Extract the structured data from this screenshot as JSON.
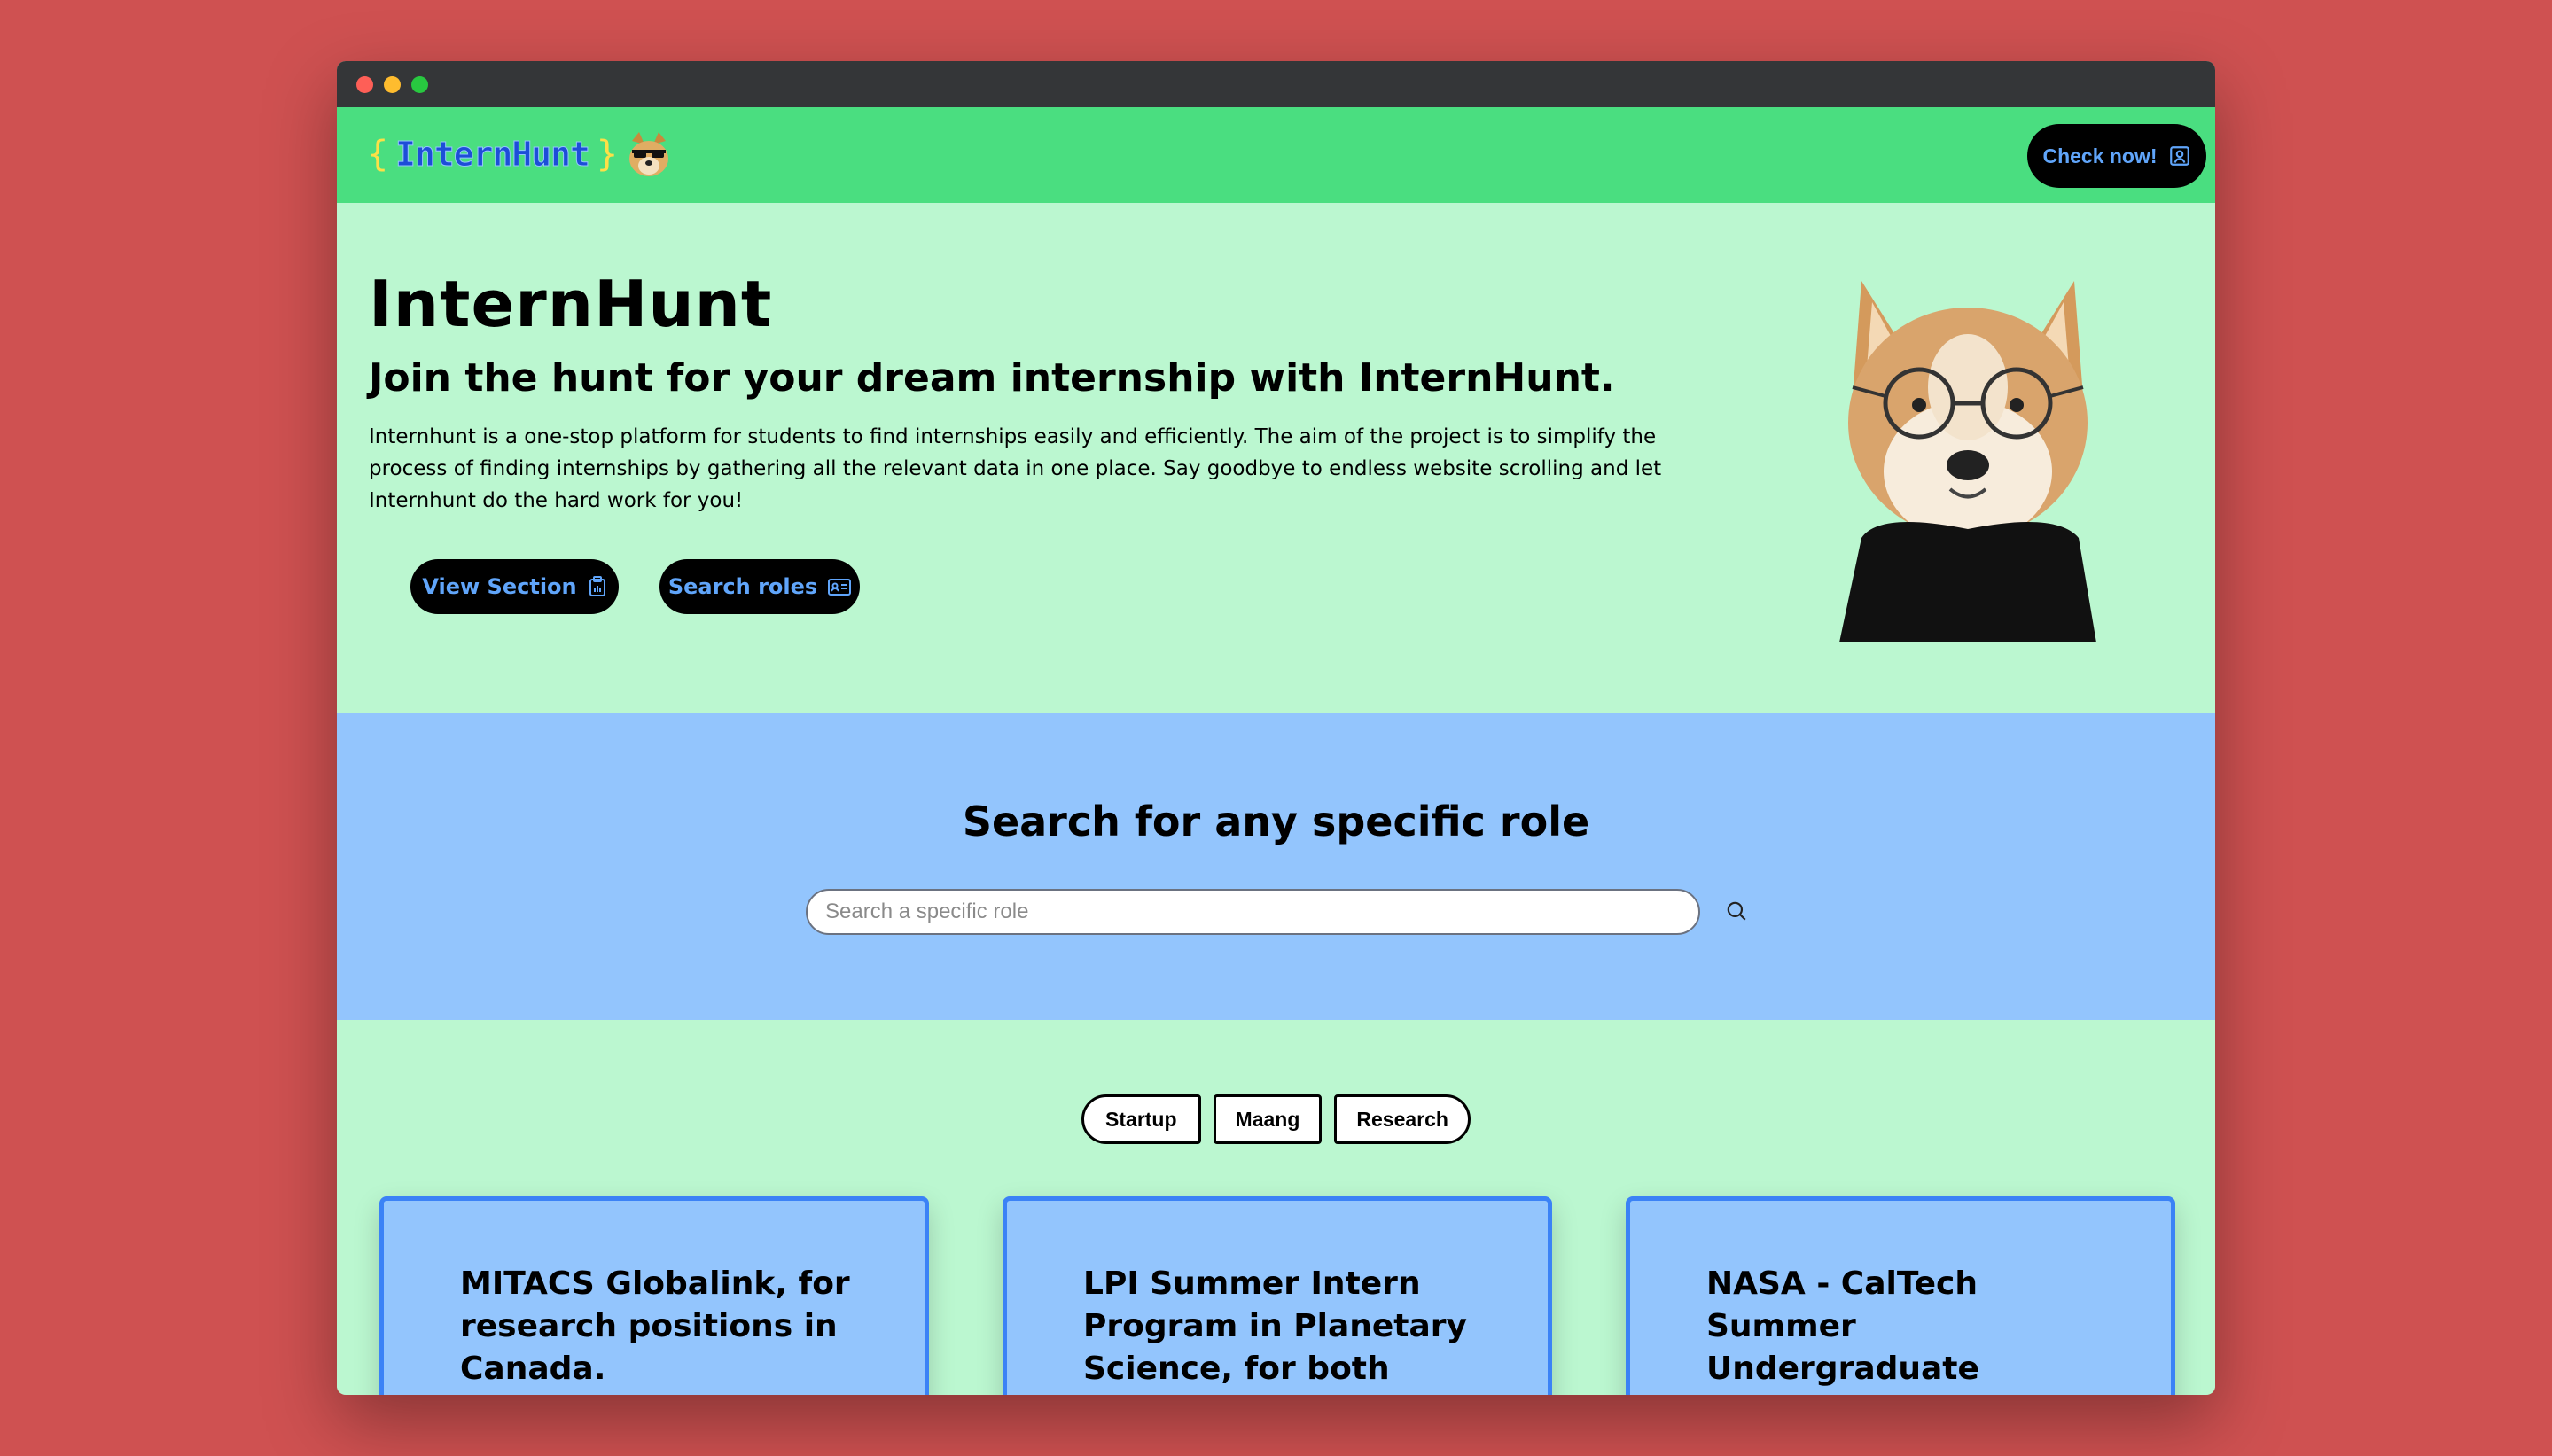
{
  "navbar": {
    "logo_text": "InternHunt",
    "logo_brace_open": "{",
    "logo_brace_close": "}",
    "check_label": "Check now!"
  },
  "hero": {
    "title": "InternHunt",
    "subtitle": "Join the hunt for your dream internship with InternHunt.",
    "description": "Internhunt is a one-stop platform for students to find internships easily and efficiently. The aim of the project is to simplify the process of finding internships by gathering all the relevant data in one place. Say goodbye to endless website scrolling and let Internhunt do the hard work for you!",
    "view_label": "View Section",
    "search_label": "Search roles"
  },
  "search": {
    "title": "Search for any specific role",
    "placeholder": "Search a specific role",
    "value": ""
  },
  "filters": [
    "Startup",
    "Maang",
    "Research"
  ],
  "cards": [
    "MITACS Globalink, for research positions in Canada.",
    "LPI Summer Intern Program in Planetary Science, for both national and international students",
    "NASA - CalTech Summer Undergraduate Research Fellowship (SURF), for research positions"
  ],
  "colors": {
    "background": "#cf5151",
    "navbar": "#4ade80",
    "hero": "#bbf7d0",
    "search_section": "#93c5fd",
    "button_bg": "#000000",
    "button_text": "#60a5fa",
    "card_border": "#3b82f6"
  },
  "icons": {
    "check": "user-square-icon",
    "view": "clipboard-icon",
    "search_roles": "id-card-icon",
    "search": "search-icon"
  }
}
